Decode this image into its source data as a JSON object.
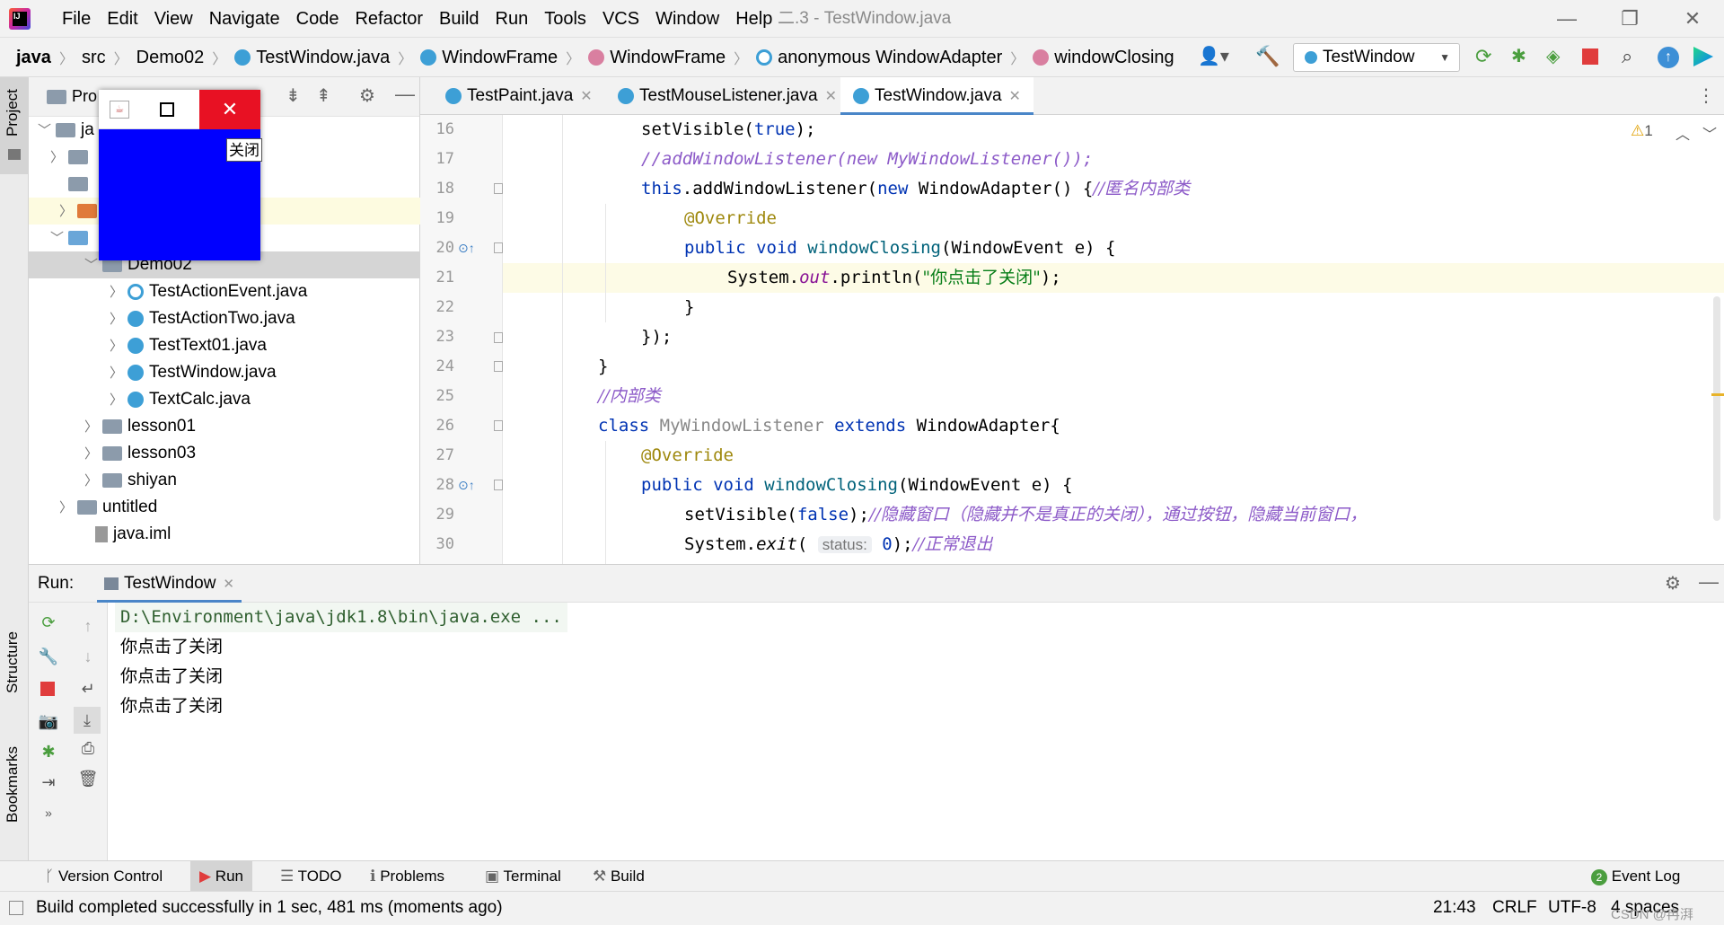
{
  "menubar": {
    "items": [
      "File",
      "Edit",
      "View",
      "Navigate",
      "Code",
      "Refactor",
      "Build",
      "Run",
      "Tools",
      "VCS",
      "Window",
      "Help"
    ],
    "window_title": "二.3 - TestWindow.java",
    "minimize": "—",
    "restore": "❐",
    "close": "✕"
  },
  "breadcrumb": {
    "items": [
      "java",
      "src",
      "Demo02",
      "TestWindow.java",
      "WindowFrame",
      "WindowFrame",
      "anonymous WindowAdapter",
      "windowClosing"
    ],
    "icons": [
      "",
      "",
      "",
      "class-icon",
      "class-icon",
      "method-icon",
      "anonymous-icon",
      "method-icon"
    ]
  },
  "run_config": {
    "label": "TestWindow",
    "dropdown": "▼"
  },
  "left_strip": {
    "project": "Project",
    "structure": "Structure",
    "bookmarks": "Bookmarks"
  },
  "project_panel": {
    "header": "Pro",
    "tree": [
      {
        "label": "Demo02",
        "level": 2
      },
      {
        "label": "TestActionEvent.java",
        "level": 3
      },
      {
        "label": "TestActionTwo.java",
        "level": 3
      },
      {
        "label": "TestText01.java",
        "level": 3
      },
      {
        "label": "TestWindow.java",
        "level": 3
      },
      {
        "label": "TextCalc.java",
        "level": 3
      },
      {
        "label": "lesson01",
        "level": 2
      },
      {
        "label": "lesson03",
        "level": 2
      },
      {
        "label": "shiyan",
        "level": 2
      },
      {
        "label": "untitled",
        "level": 1
      },
      {
        "label": "java.iml",
        "level": 1
      }
    ]
  },
  "editor": {
    "tabs": [
      "TestPaint.java",
      "TestMouseListener.java",
      "TestWindow.java"
    ],
    "active_tab": "TestWindow.java",
    "warning_count": "1",
    "line_numbers": [
      "16",
      "17",
      "18",
      "19",
      "20",
      "21",
      "22",
      "23",
      "24",
      "25",
      "26",
      "27",
      "28",
      "29",
      "30"
    ],
    "lines": {
      "l16": {
        "a": "setVisible(",
        "b": "true",
        "c": ");"
      },
      "l17": "//addWindowListener(new MyWindowListener());",
      "l18": {
        "a": "this",
        "b": ".addWindowListener(",
        "c": "new",
        "d": " WindowAdapter() {",
        "e": "//匿名内部类"
      },
      "l19": "@Override",
      "l20": {
        "a": "public void ",
        "b": "windowClosing",
        "c": "(WindowEvent e) {"
      },
      "l21": {
        "a": "System.",
        "b": "out",
        "c": ".println(",
        "d": "\"你点击了关闭\"",
        "e": ");"
      },
      "l22": "}",
      "l23": "});",
      "l24": "}",
      "l25": "//内部类",
      "l26": {
        "a": "class ",
        "b": "MyWindowListener ",
        "c": "extends ",
        "d": "WindowAdapter{"
      },
      "l27": "@Override",
      "l28": {
        "a": "public void ",
        "b": "windowClosing",
        "c": "(WindowEvent e) {"
      },
      "l29": {
        "a": "setVisible(",
        "b": "false",
        "c": ");",
        "d": "//隐藏窗口（隐藏并不是真正的关闭），通过按钮，隐藏当前窗口，"
      },
      "l30": {
        "a": "System.",
        "b": "exit",
        "c": "( ",
        "d": "status:",
        "e": " 0",
        "f": ");",
        "g": "//正常退出"
      }
    }
  },
  "run_panel": {
    "label": "Run:",
    "tab": "TestWindow",
    "console": [
      "D:\\Environment\\java\\jdk1.8\\bin\\java.exe ...",
      "你点击了关闭",
      "你点击了关闭",
      "你点击了关闭"
    ]
  },
  "bottom_tabs": [
    "Version Control",
    "Run",
    "TODO",
    "Problems",
    "Terminal",
    "Build"
  ],
  "event_log": {
    "label": "Event Log",
    "count": "2"
  },
  "status": {
    "message": "Build completed successfully in 1 sec, 481 ms (moments ago)",
    "position": "21:43",
    "line_sep": "CRLF",
    "encoding": "UTF-8",
    "indent": "4 spaces",
    "watermark": "CSDN @冉湃"
  },
  "java_window": {
    "tooltip": "关闭",
    "color": "#0000ff"
  }
}
